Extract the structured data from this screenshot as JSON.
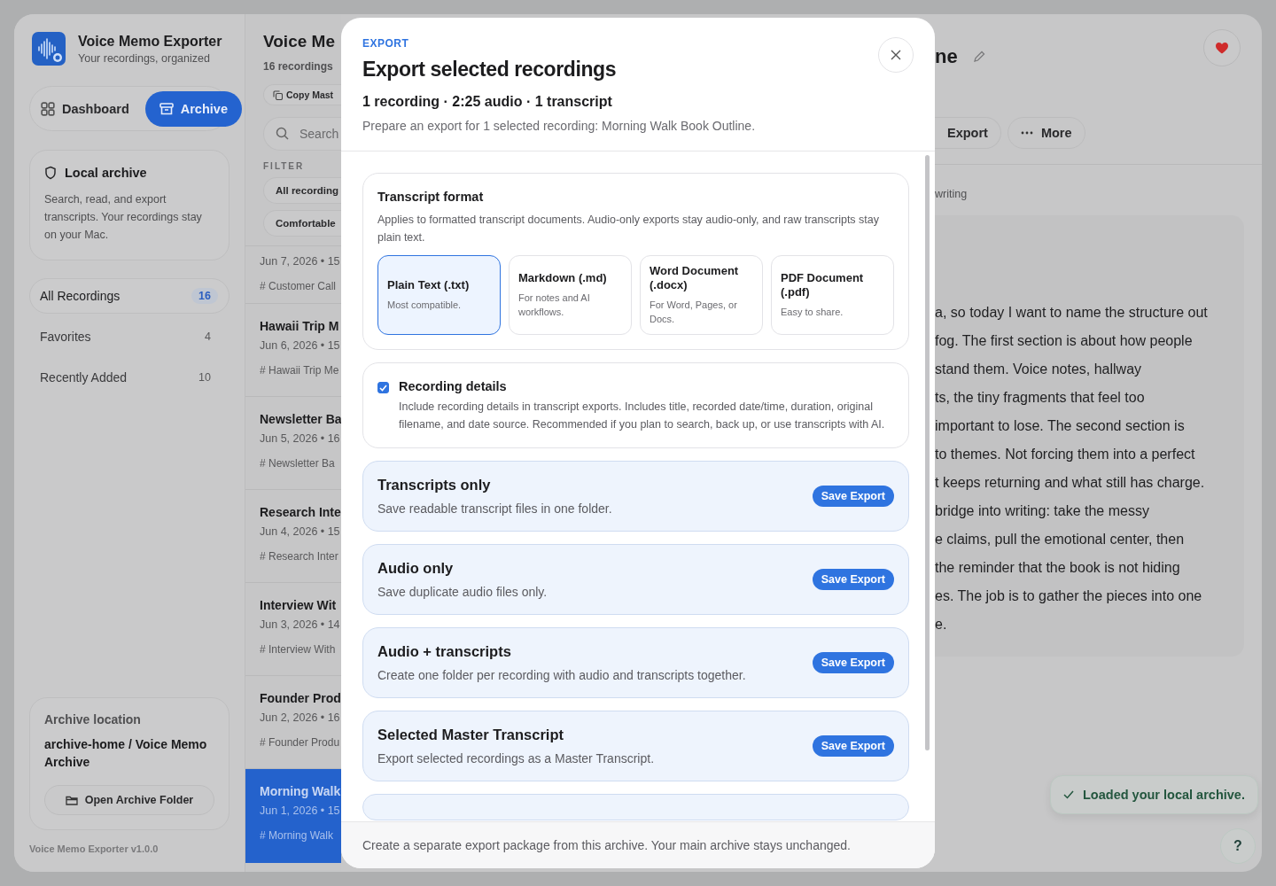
{
  "sidebar": {
    "app_title": "Voice Memo Exporter",
    "app_subtitle": "Your recordings, organized",
    "segments": [
      {
        "label": "Dashboard",
        "kind": "grid",
        "selected": false
      },
      {
        "label": "Archive",
        "kind": "archive",
        "selected": true
      }
    ],
    "info_card": {
      "title": "Local archive",
      "text": "Search, read, and export transcripts. Your recordings stay on your Mac."
    },
    "nav": [
      {
        "label": "All Recordings",
        "count": "16",
        "selected": true
      },
      {
        "label": "Favorites",
        "count": "4",
        "selected": false
      },
      {
        "label": "Recently Added",
        "count": "10",
        "selected": false
      }
    ],
    "location_card": {
      "label": "Archive location",
      "path": "archive-home / Voice Memo Archive",
      "button": "Open Archive Folder"
    },
    "version": "Voice Memo Exporter v1.0.0"
  },
  "recordings_pane": {
    "title": "Voice Me",
    "count": "16 recordings",
    "copy_button": "Copy Mast",
    "search": {
      "placeholder": "Search"
    },
    "filter_label": "FILTER",
    "filters": [
      "All recording",
      "Comfortable"
    ],
    "rows": [
      {
        "meta": "Jun 7, 2026 • 15",
        "tag": "# Customer Call",
        "selected": false
      },
      {
        "title": "Hawaii Trip M",
        "meta": "Jun 6, 2026 • 15",
        "tag": "# Hawaii Trip Me",
        "selected": false
      },
      {
        "title": "Newsletter Ba",
        "meta": "Jun 5, 2026 • 16",
        "tag": "# Newsletter Ba",
        "selected": false
      },
      {
        "title": "Research Inte",
        "meta": "Jun 4, 2026 • 15",
        "tag": "# Research Inter",
        "selected": false
      },
      {
        "title": "Interview Wit",
        "meta": "Jun 3, 2026 • 14",
        "tag": "# Interview With",
        "selected": false
      },
      {
        "title": "Founder Prod",
        "meta": "Jun 2, 2026 • 16",
        "tag": "# Founder Produ",
        "selected": false
      },
      {
        "title": "Morning Walk",
        "meta": "Jun 1, 2026 • 15",
        "tag": "# Morning Walk",
        "selected": true
      }
    ]
  },
  "detail_pane": {
    "title": "ne",
    "favorite": true,
    "buttons": [
      {
        "label": "Export",
        "kind": "plain"
      },
      {
        "label": "More",
        "kind": "more"
      }
    ],
    "meta_text": "writing",
    "transcript_lines": [
      "a, so today I want to name the structure out",
      "fog. The first section is about how people",
      "stand them. Voice notes, hallway",
      "ts, the tiny fragments that feel too",
      "important to lose. The second section is",
      "to themes. Not forcing them into a perfect",
      "t keeps returning and what still has charge.",
      "bridge into writing: take the messy",
      "e claims, pull the emotional center, then",
      "the reminder that the book is not hiding",
      "es. The job is to gather the pieces into one",
      "e."
    ],
    "toast": "Loaded your local archive.",
    "help": "?"
  },
  "export_dialog": {
    "eyebrow": "EXPORT",
    "title": "Export selected recordings",
    "summary": "1 recording · 2:25 audio · 1 transcript",
    "description": "Prepare an export for 1 selected recording: Morning Walk Book Outline.",
    "format_card": {
      "title": "Transcript format",
      "text": "Applies to formatted transcript documents. Audio-only exports stay audio-only, and raw transcripts stay plain text.",
      "options": [
        {
          "name": "Plain Text (.txt)",
          "desc": "Most compatible.",
          "selected": true
        },
        {
          "name": "Markdown (.md)",
          "desc": "For notes and AI workflows.",
          "selected": false
        },
        {
          "name": "Word Document (.docx)",
          "desc": "For Word, Pages, or Docs.",
          "selected": false
        },
        {
          "name": "PDF Document (.pdf)",
          "desc": "Easy to share.",
          "selected": false
        }
      ]
    },
    "details_card": {
      "title": "Recording details",
      "text": "Include recording details in transcript exports. Includes title, recorded date/time, duration, original filename, and date source. Recommended if you plan to search, back up, or use transcripts with AI.",
      "checked": true
    },
    "options": [
      {
        "title": "Transcripts only",
        "desc": "Save readable transcript files in one folder.",
        "button": "Save Export"
      },
      {
        "title": "Audio only",
        "desc": "Save duplicate audio files only.",
        "button": "Save Export"
      },
      {
        "title": "Audio + transcripts",
        "desc": "Create one folder per recording with audio and transcripts together.",
        "button": "Save Export"
      },
      {
        "title": "Selected Master Transcript",
        "desc": "Export selected recordings as a Master Transcript.",
        "button": "Save Export"
      }
    ],
    "footer": "Create a separate export package from this archive. Your main archive stays unchanged."
  }
}
